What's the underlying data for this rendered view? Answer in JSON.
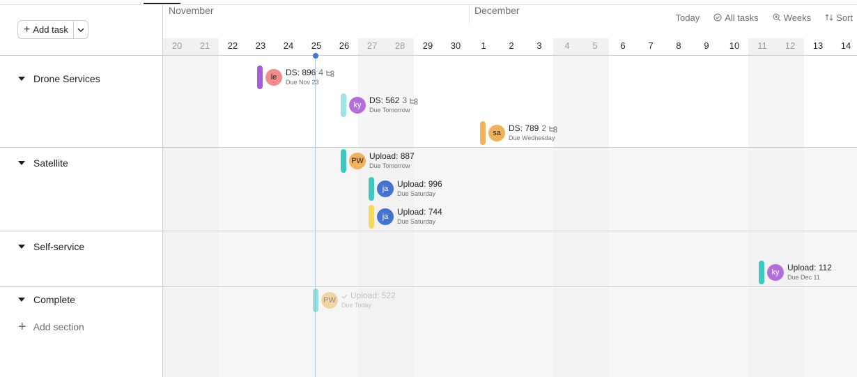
{
  "toolbar": {
    "add_task": "Add task",
    "today": "Today",
    "all_tasks": "All tasks",
    "weeks": "Weeks",
    "sort": "Sort"
  },
  "months": [
    "November",
    "December"
  ],
  "days": [
    "20",
    "21",
    "22",
    "23",
    "24",
    "25",
    "26",
    "27",
    "28",
    "29",
    "30",
    "1",
    "2",
    "3",
    "4",
    "5",
    "6",
    "7",
    "8",
    "9",
    "10",
    "11",
    "12",
    "13",
    "14"
  ],
  "sections": [
    {
      "name": "Drone Services"
    },
    {
      "name": "Satellite"
    },
    {
      "name": "Self-service"
    },
    {
      "name": "Complete"
    }
  ],
  "add_section": "Add section",
  "tasks": [
    {
      "name": "DS: 896",
      "count": "4",
      "due": "Due Nov 23",
      "avatar": "le",
      "avatar_color": "#f28b8b",
      "bar_color": "#a55ed6"
    },
    {
      "name": "DS: 562",
      "count": "3",
      "due": "Due Tomorrow",
      "avatar": "ky",
      "avatar_color": "#b26ed9",
      "bar_color": "#9ee4e1"
    },
    {
      "name": "DS: 789",
      "count": "2",
      "due": "Due Wednesday",
      "avatar": "sa",
      "avatar_color": "#f0b35b",
      "bar_color": "#f0b35b"
    },
    {
      "name": "Upload: 887",
      "due": "Due Tomorrow",
      "avatar": "PW",
      "avatar_color": "#f0b35b",
      "bar_color": "#3ec8c0"
    },
    {
      "name": "Upload: 996",
      "due": "Due Saturday",
      "avatar": "ja",
      "avatar_color": "#4573d2",
      "bar_color": "#3ec8c0"
    },
    {
      "name": "Upload: 744",
      "due": "Due Saturday",
      "avatar": "ja",
      "avatar_color": "#4573d2",
      "bar_color": "#f5d85e"
    },
    {
      "name": "Upload: 112",
      "due": "Due Dec 11",
      "avatar": "ky",
      "avatar_color": "#b26ed9",
      "bar_color": "#3ec8c0"
    },
    {
      "name": "Upload: 522",
      "due": "Due Today",
      "avatar": "PW",
      "avatar_color": "#f0b35b",
      "bar_color": "#3ec8c0",
      "completed": true
    }
  ]
}
